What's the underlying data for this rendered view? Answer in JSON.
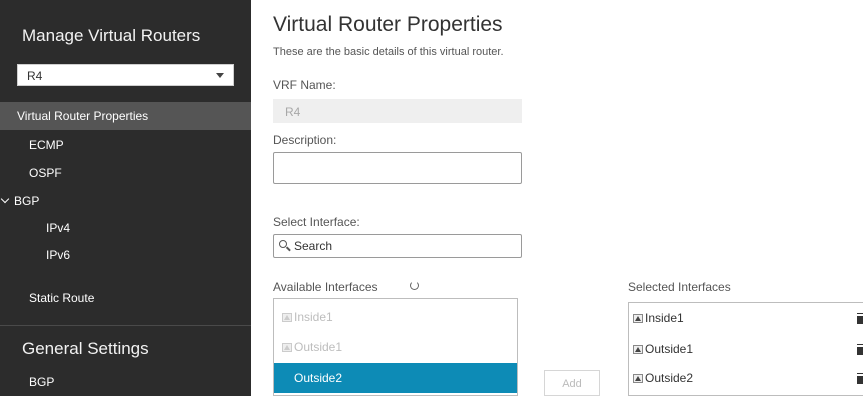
{
  "sidebar": {
    "title": "Manage Virtual Routers",
    "router_select": "R4",
    "items": [
      {
        "label": "Virtual Router Properties"
      },
      {
        "label": "ECMP"
      },
      {
        "label": "OSPF"
      },
      {
        "label": "BGP"
      },
      {
        "label": "IPv4"
      },
      {
        "label": "IPv6"
      },
      {
        "label": "Static Route"
      }
    ],
    "general_title": "General Settings",
    "general_items": [
      {
        "label": "BGP"
      }
    ]
  },
  "main": {
    "title": "Virtual Router Properties",
    "subtitle": "These are the basic details of this virtual router.",
    "vrf_label": "VRF Name:",
    "vrf_value": "R4",
    "description_label": "Description:",
    "description_value": "",
    "select_interface_label": "Select Interface:",
    "search_placeholder": "Search",
    "available_label": "Available Interfaces",
    "selected_label": "Selected Interfaces",
    "available": [
      {
        "label": "Inside1",
        "state": "disabled"
      },
      {
        "label": "Outside1",
        "state": "disabled"
      },
      {
        "label": "Outside2",
        "state": "selected"
      }
    ],
    "selected": [
      {
        "label": "Inside1"
      },
      {
        "label": "Outside1"
      },
      {
        "label": "Outside2"
      }
    ],
    "add_label": "Add"
  },
  "colors": {
    "sidebar_bg": "#2c2c2c",
    "sidebar_active": "#555555",
    "selection_blue": "#0d8bb6"
  },
  "icons": [
    "chevron-down-icon",
    "search-icon",
    "refresh-icon",
    "interface-icon",
    "trash-icon"
  ]
}
